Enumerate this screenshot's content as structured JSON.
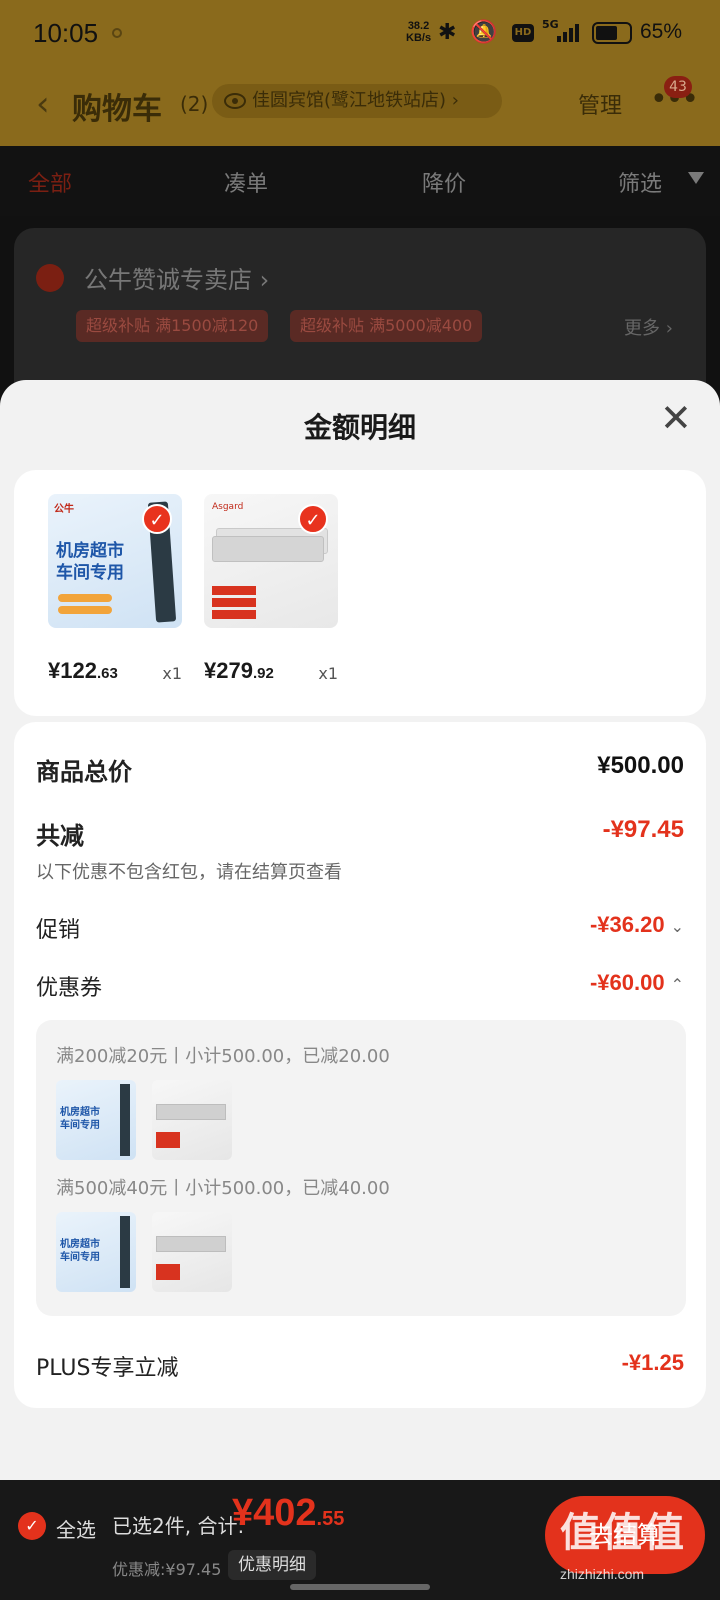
{
  "status": {
    "time": "10:05",
    "net_speed": "38.2",
    "net_unit": "KB/s",
    "hd": "HD",
    "network": "5G",
    "battery_pct": "65%",
    "battery_level": 0.65
  },
  "header": {
    "back": "‹",
    "title": "购物车",
    "count": "(2)",
    "location": "佳圆宾馆(鹭江地铁站店)",
    "location_chevron": "›",
    "manage": "管理",
    "more": "•••",
    "badge": "43"
  },
  "tabs": [
    {
      "label": "全部"
    },
    {
      "label": "凑单"
    },
    {
      "label": "降价"
    },
    {
      "label": "筛选"
    }
  ],
  "store": {
    "name": "公牛赞诚专卖店",
    "chevron": "›",
    "chips": [
      "超级补贴 满1500减120",
      "超级补贴 满5000减400"
    ],
    "more": "更多 ›"
  },
  "sheet": {
    "title": "金额明细",
    "close": "✕",
    "products": [
      {
        "price_int": "¥122",
        "price_dec": ".63",
        "qty": "x1",
        "brand": "公牛",
        "text": "机房超市\n车间专用",
        "style": "blue"
      },
      {
        "price_int": "¥279",
        "price_dec": ".92",
        "qty": "x1",
        "brand": "Asgard",
        "style": "white"
      }
    ],
    "check": "✓",
    "total_label": "商品总价",
    "total_value": "¥500.00",
    "reduce_label": "共减",
    "reduce_value": "-¥97.45",
    "note": "以下优惠不包含红包，请在结算页查看",
    "promo_label": "促销",
    "promo_value": "-¥36.20",
    "promo_chev": "⌄",
    "coupon_label": "优惠券",
    "coupon_value": "-¥60.00",
    "coupon_chev": "⌃",
    "coupon_rules": [
      "满200减20元丨小计500.00，已减20.00",
      "满500减40元丨小计500.00，已减40.00"
    ],
    "plus_label": "PLUS专享立减",
    "plus_value": "-¥1.25"
  },
  "bottom": {
    "check": "✓",
    "select_all": "全选",
    "selected": "已选2件, 合计:",
    "total_int": "¥402",
    "total_dec": ".55",
    "discount": "优惠减:¥97.45",
    "detail_btn": "优惠明细",
    "checkout": "去结算"
  },
  "watermark": {
    "main": "值值值",
    "sub": "zhizhizhi.com"
  }
}
